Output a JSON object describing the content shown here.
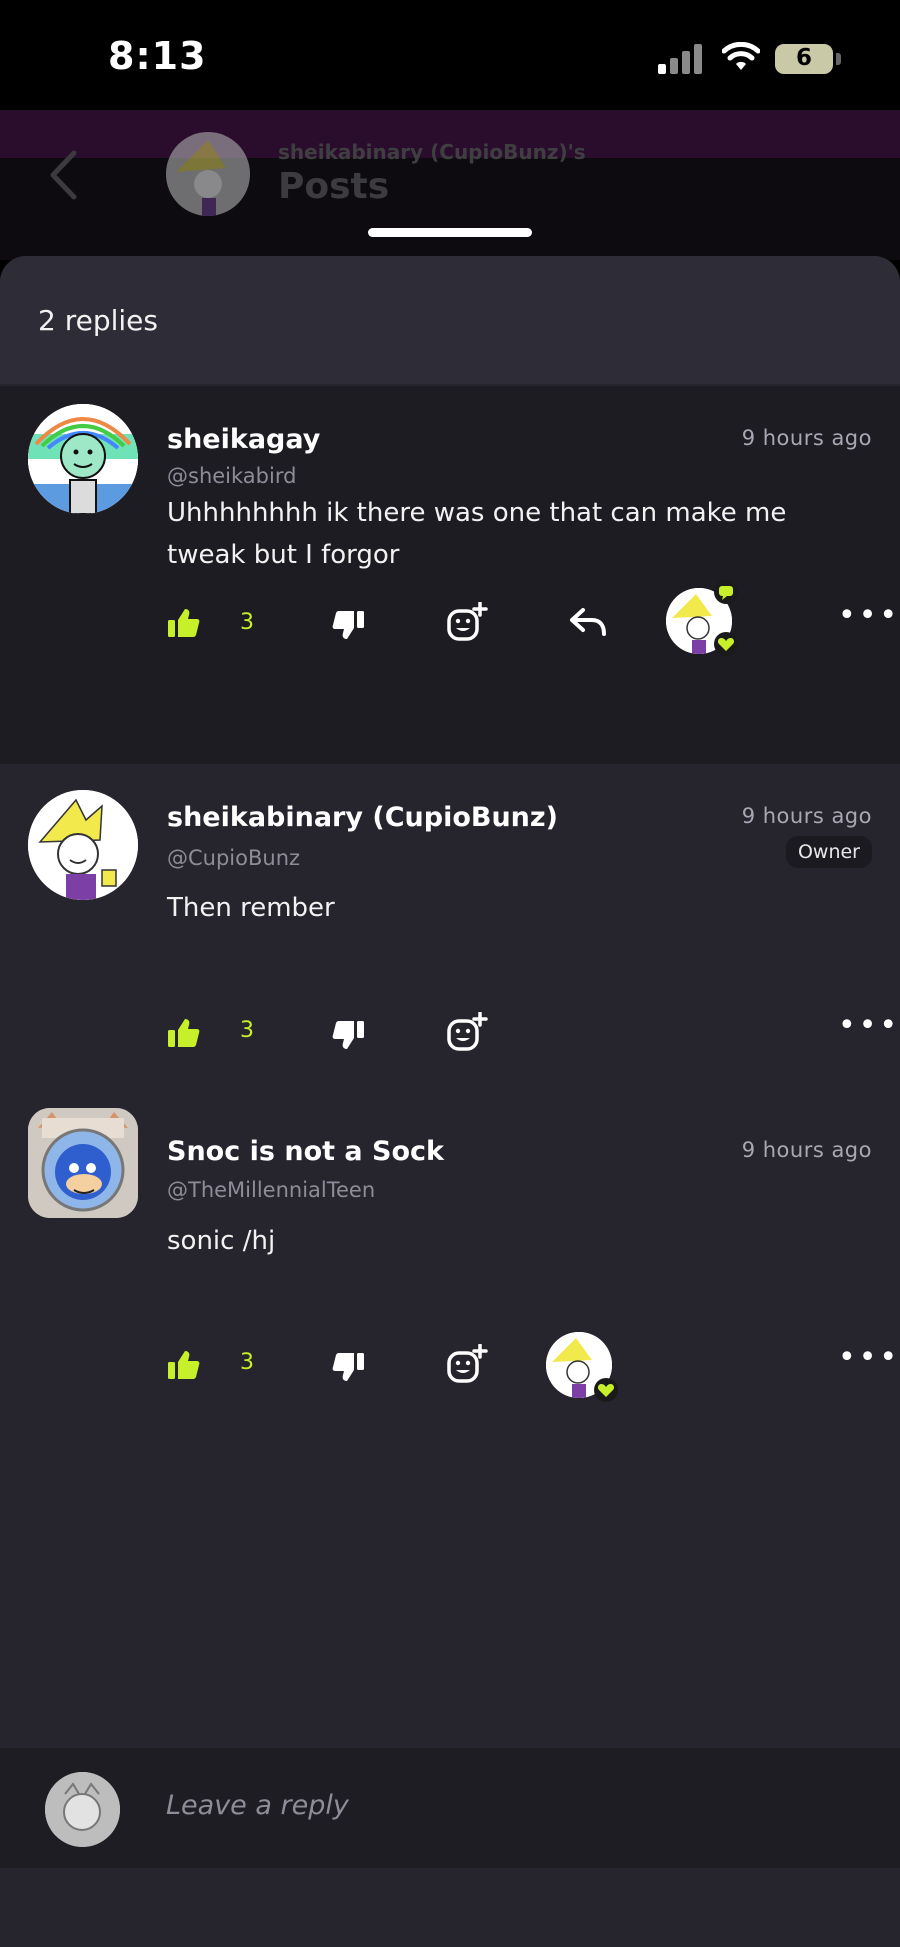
{
  "status": {
    "time": "8:13",
    "battery": "6"
  },
  "header": {
    "subtitle": "sheikabinary (CupioBunz)'s",
    "title": "Posts"
  },
  "replies_label": "2 replies",
  "comments": [
    {
      "name": "sheikagay",
      "handle": "@sheikabird",
      "time": "9 hours ago",
      "text": "Uhhhhhhhh ik there was one that can make me tweak but I forgor",
      "likes": "3"
    },
    {
      "name": "sheikabinary (CupioBunz)",
      "handle": "@CupioBunz",
      "time": "9 hours ago",
      "badge": "Owner",
      "text": "Then rember",
      "likes": "3"
    },
    {
      "name": "Snoc is not a Sock",
      "handle": "@TheMillennialTeen",
      "time": "9 hours ago",
      "text": "sonic /hj",
      "likes": "3"
    }
  ],
  "reply_placeholder": "Leave a reply",
  "colors": {
    "accent": "#c7f02b",
    "sheet": "#26252e",
    "highlight": "#1d1c23"
  }
}
